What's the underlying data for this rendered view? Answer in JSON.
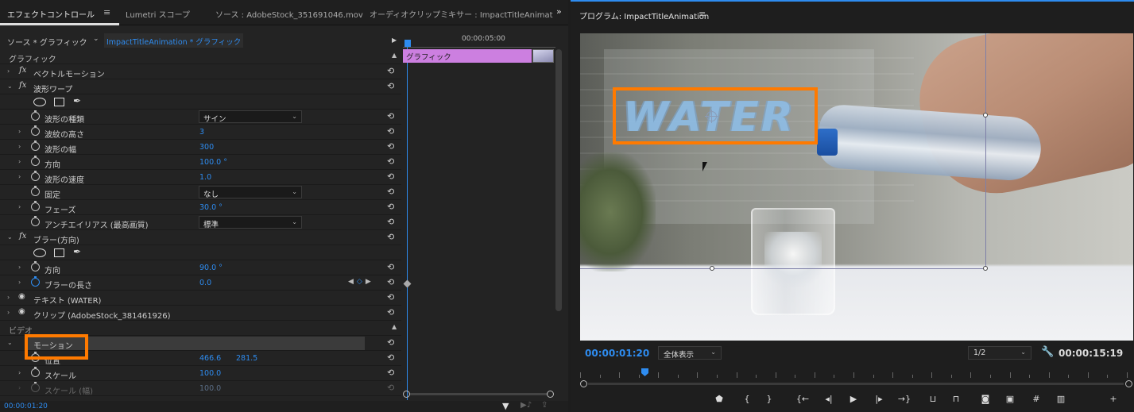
{
  "left_tabs": {
    "effect_controls": "エフェクトコントロール",
    "menu_glyph": "≡",
    "lumetri": "Lumetri スコープ",
    "source": "ソース : AdobeStock_351691046.mov",
    "audio_mixer": "オーディオクリップミキサー : ImpactTitleAnimat",
    "more": "»"
  },
  "source_row": {
    "label": "ソース * グラフィック",
    "sequence": "ImpactTitleAnimation * グラフィック"
  },
  "sections": {
    "graphic": "グラフィック",
    "video": "ビデオ"
  },
  "effects": {
    "vector_motion": "ベクトルモーション",
    "wave_warp": "波形ワープ",
    "wave_type": "波形の種類",
    "wave_type_value": "サイン",
    "wave_height": "波紋の高さ",
    "wave_height_value": "3",
    "wave_width": "波形の幅",
    "wave_width_value": "300",
    "direction": "方向",
    "direction_value": "100.0 °",
    "wave_speed": "波形の速度",
    "wave_speed_value": "1.0",
    "pinning": "固定",
    "pinning_value": "なし",
    "phase": "フェーズ",
    "phase_value": "30.0 °",
    "antialias": "アンチエイリアス (最高画質)",
    "antialias_value": "標準",
    "directional_blur": "ブラー(方向)",
    "blur_direction": "方向",
    "blur_direction_value": "90.0 °",
    "blur_length": "ブラーの長さ",
    "blur_length_value": "0.0",
    "text_layer": "テキスト (WATER)",
    "clip_layer": "クリップ (AdobeStock_381461926)",
    "motion": "モーション",
    "position": "位置",
    "position_x": "466.6",
    "position_y": "281.5",
    "scale": "スケール",
    "scale_value": "100.0",
    "scale_width": "スケール (幅)",
    "scale_width_value": "100.0"
  },
  "mini_timeline": {
    "time": "00:00:05:00",
    "clip_label": "グラフィック"
  },
  "left_footer": {
    "timecode": "00:00:01:20"
  },
  "program": {
    "title": "プログラム: ImpactTitleAnimation",
    "overlay_text": "WATER",
    "timecode_current": "00:00:01:20",
    "zoom": "全体表示",
    "resolution": "1/2",
    "timecode_duration": "00:00:15:19",
    "playhead_fraction": 0.11
  },
  "transport": {
    "marker": "⬟",
    "in_point": "{",
    "out_point": "}",
    "go_to_in": "{←",
    "step_back": "◂|",
    "play": "▶",
    "step_forward": "|▸",
    "go_to_out": "→}",
    "lift": "⊔",
    "extract": "⊓",
    "export_frame": "◙",
    "comparison": "▣",
    "safe_margins": "#",
    "multi": "▥",
    "add": "+"
  },
  "colors": {
    "accent": "#2e8cf0",
    "highlight_box": "#ff7a00",
    "clip": "#cc7fe0"
  }
}
